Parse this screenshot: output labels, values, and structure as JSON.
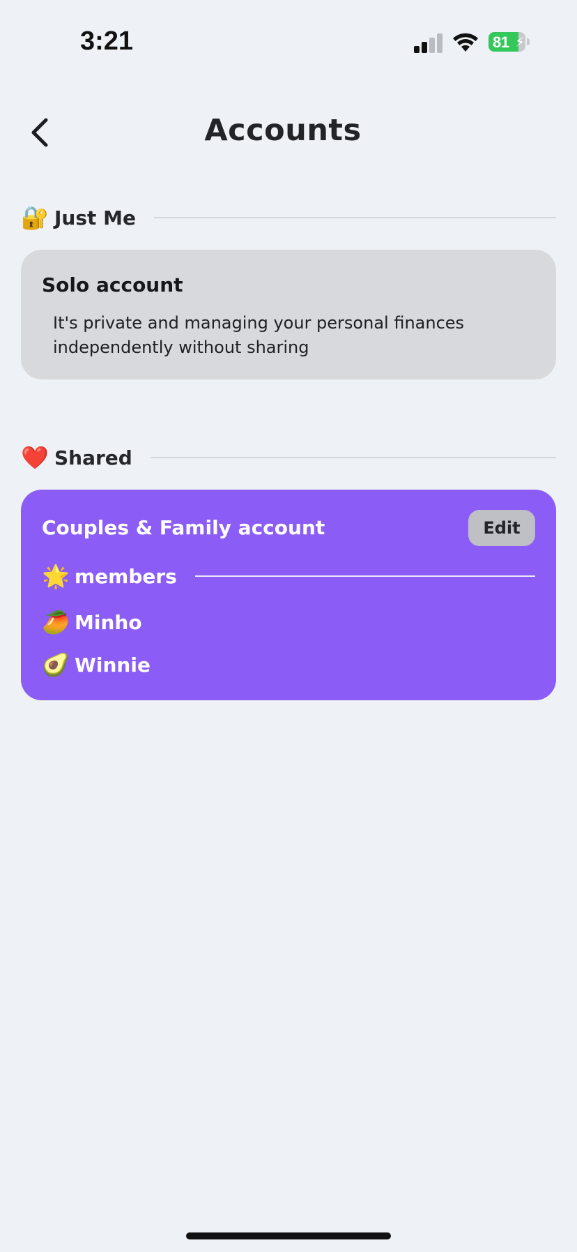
{
  "status_bar": {
    "time": "3:21",
    "battery_level": "81",
    "battery_fraction": 0.81,
    "signal_icon": "cellular-signal-icon",
    "wifi_icon": "wifi-icon",
    "battery_icon": "battery-charging-icon"
  },
  "header": {
    "title": "Accounts",
    "back_icon": "chevron-left-icon"
  },
  "sections": {
    "just_me": {
      "emoji": "🔐",
      "label": "Just Me",
      "card": {
        "title": "Solo account",
        "description": "It's private and managing your personal finances independently without sharing"
      }
    },
    "shared": {
      "emoji": "❤️",
      "label": "Shared",
      "card": {
        "title": "Couples & Family account",
        "edit_label": "Edit",
        "members_emoji": "🌟",
        "members_label": "members",
        "members": [
          {
            "emoji": "🥭",
            "name": "Minho"
          },
          {
            "emoji": "🥑",
            "name": "Winnie"
          }
        ]
      }
    }
  },
  "colors": {
    "background": "#eef2f6",
    "solo_card": "#d8d9dc",
    "shared_card": "#8b5cf6",
    "edit_button": "#bfbfc6",
    "battery_green": "#34c759"
  }
}
